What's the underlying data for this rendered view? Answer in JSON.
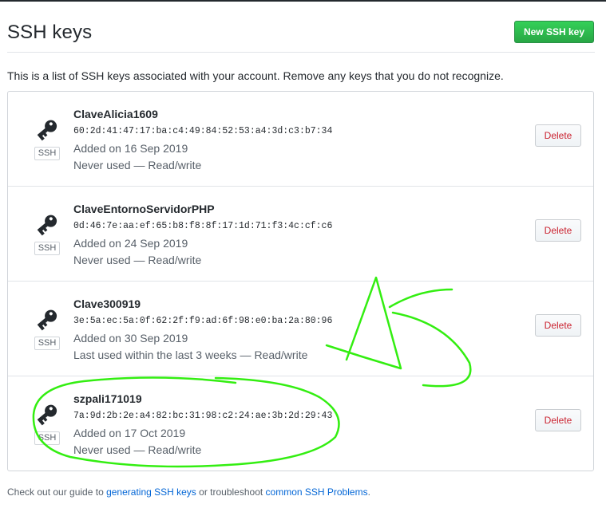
{
  "page": {
    "title": "SSH keys",
    "new_button_label": "New SSH key",
    "intro": "This is a list of SSH keys associated with your account. Remove any keys that you do not recognize."
  },
  "keys": [
    {
      "title": "ClaveAlicia1609",
      "fingerprint": "60:2d:41:47:17:ba:c4:49:84:52:53:a4:3d:c3:b7:34",
      "added": "Added on 16 Sep 2019",
      "usage": "Never used — Read/write",
      "badge": "SSH",
      "delete_label": "Delete"
    },
    {
      "title": "ClaveEntornoServidorPHP",
      "fingerprint": "0d:46:7e:aa:ef:65:b8:f8:8f:17:1d:71:f3:4c:cf:c6",
      "added": "Added on 24 Sep 2019",
      "usage": "Never used — Read/write",
      "badge": "SSH",
      "delete_label": "Delete"
    },
    {
      "title": "Clave300919",
      "fingerprint": "3e:5a:ec:5a:0f:62:2f:f9:ad:6f:98:e0:ba:2a:80:96",
      "added": "Added on 30 Sep 2019",
      "usage": "Last used within the last 3 weeks — Read/write",
      "badge": "SSH",
      "delete_label": "Delete"
    },
    {
      "title": "szpali171019",
      "fingerprint": "7a:9d:2b:2e:a4:82:bc:31:98:c2:24:ae:3b:2d:29:43",
      "added": "Added on 17 Oct 2019",
      "usage": "Never used — Read/write",
      "badge": "SSH",
      "delete_label": "Delete"
    }
  ],
  "footer": {
    "prefix": "Check out our guide to ",
    "link1": "generating SSH keys",
    "middle": " or troubleshoot ",
    "link2": "common SSH Problems",
    "suffix": "."
  },
  "icons": {
    "key": "key-icon"
  },
  "colors": {
    "primary_button": "#28a745",
    "danger_text": "#cb2431",
    "link": "#0366d6",
    "annotation": "#33ee11"
  }
}
